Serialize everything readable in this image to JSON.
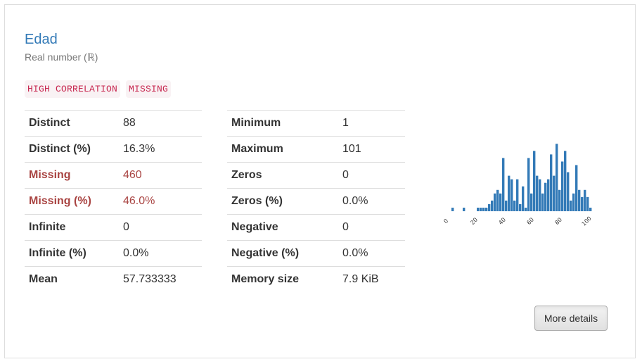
{
  "variable": {
    "name": "Edad",
    "type": "Real number (ℝ)",
    "badges": [
      "HIGH CORRELATION",
      "MISSING"
    ]
  },
  "left_table": [
    {
      "label": "Distinct",
      "value": "88",
      "alert": false
    },
    {
      "label": "Distinct (%)",
      "value": "16.3%",
      "alert": false
    },
    {
      "label": "Missing",
      "value": "460",
      "alert": true
    },
    {
      "label": "Missing (%)",
      "value": "46.0%",
      "alert": true
    },
    {
      "label": "Infinite",
      "value": "0",
      "alert": false
    },
    {
      "label": "Infinite (%)",
      "value": "0.0%",
      "alert": false
    },
    {
      "label": "Mean",
      "value": "57.733333",
      "alert": false
    }
  ],
  "right_table": [
    {
      "label": "Minimum",
      "value": "1"
    },
    {
      "label": "Maximum",
      "value": "101"
    },
    {
      "label": "Zeros",
      "value": "0"
    },
    {
      "label": "Zeros (%)",
      "value": "0.0%"
    },
    {
      "label": "Negative",
      "value": "0"
    },
    {
      "label": "Negative (%)",
      "value": "0.0%"
    },
    {
      "label": "Memory size",
      "value": "7.9 KiB"
    }
  ],
  "actions": {
    "more_details": "More details"
  },
  "colors": {
    "bar": "#337ab7",
    "title": "#337ab7",
    "alert": "#a94442",
    "badge_text": "#c7254e"
  },
  "chart_data": {
    "type": "bar",
    "xlim": [
      0,
      102
    ],
    "ylim": [
      0,
      25
    ],
    "tick_labels": [
      "0",
      "20",
      "40",
      "60",
      "80",
      "100"
    ],
    "tick_values": [
      0,
      20,
      40,
      60,
      80,
      100
    ],
    "bins_start": 1,
    "bin_width": 1,
    "values": [
      1,
      0,
      0,
      0,
      1,
      0,
      0,
      0,
      0,
      1,
      1,
      1,
      1,
      2,
      3,
      5,
      6,
      5,
      15,
      3,
      10,
      9,
      3,
      9,
      2,
      7,
      1,
      15,
      5,
      17,
      10,
      9,
      5,
      8,
      9,
      16,
      10,
      19,
      6,
      14,
      17,
      11,
      3,
      5,
      13,
      6,
      4,
      6,
      4,
      1
    ]
  }
}
